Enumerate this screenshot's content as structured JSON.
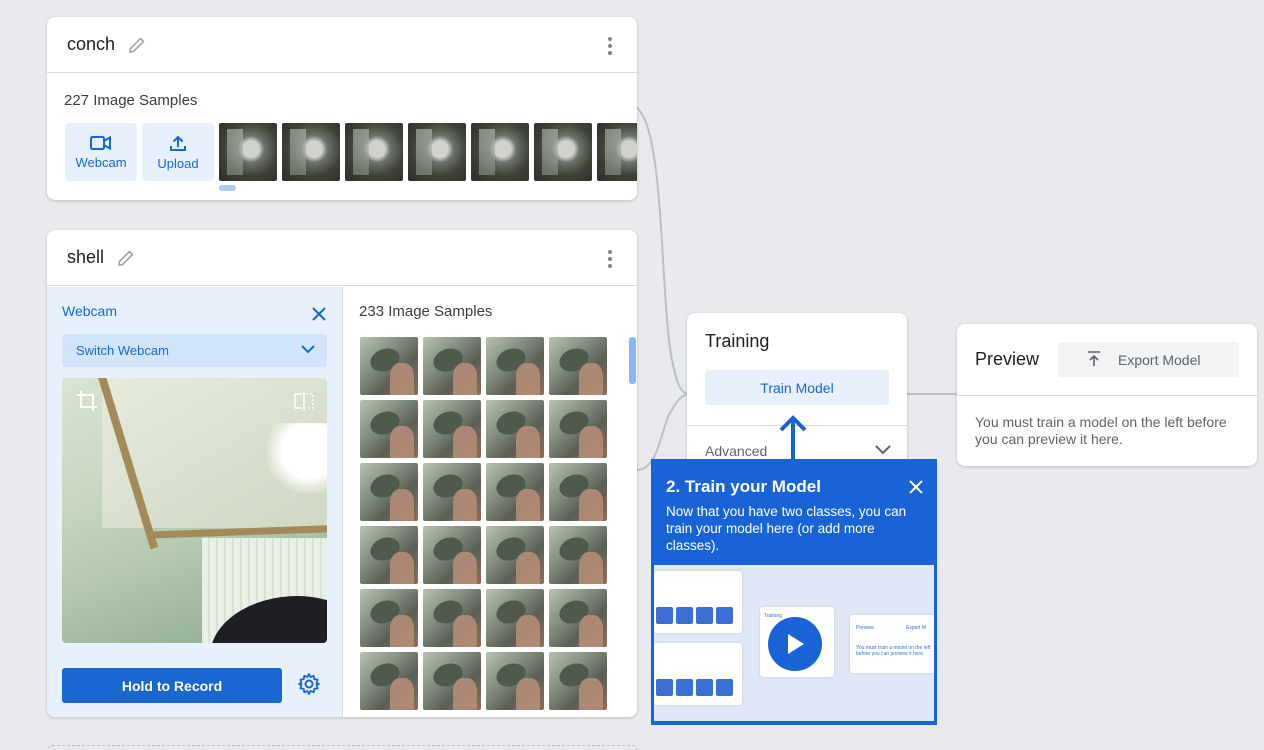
{
  "classes": [
    {
      "name": "conch",
      "samples_label": "227 Image Samples",
      "webcam_label": "Webcam",
      "upload_label": "Upload"
    },
    {
      "name": "shell",
      "samples_label": "233 Image Samples",
      "webcam_panel": {
        "title": "Webcam",
        "switch_label": "Switch Webcam",
        "record_label": "Hold to Record"
      }
    }
  ],
  "training": {
    "title": "Training",
    "train_button": "Train Model",
    "advanced_label": "Advanced"
  },
  "preview": {
    "title": "Preview",
    "export_button": "Export Model",
    "message": "You must train a model on the left before you can preview it here."
  },
  "tooltip": {
    "title": "2. Train your Model",
    "body": "Now that you have two classes, you can train your model here (or add more classes).",
    "video": {
      "training_label": "Training",
      "preview_label": "Preview",
      "export_label": "Export M",
      "preview_msg": "You must train a model on the left before you can preview it here."
    }
  },
  "colors": {
    "accent": "#1967d2",
    "accent_light": "#e8f0fe",
    "background": "#e8eaed",
    "tooltip_bg": "#1a63d6"
  }
}
